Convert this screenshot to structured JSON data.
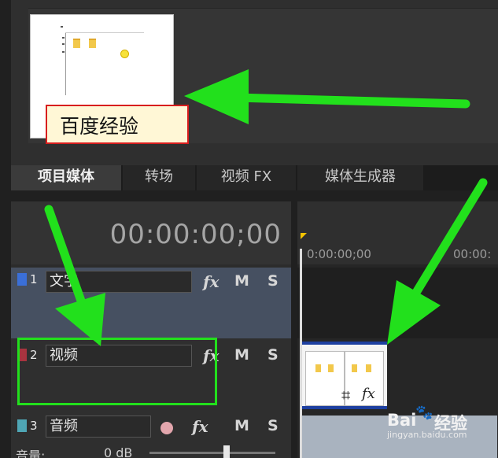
{
  "preview": {
    "label": "百度经验"
  },
  "tabs": [
    {
      "label": "项目媒体",
      "active": true
    },
    {
      "label": "转场",
      "active": false
    },
    {
      "label": "视频 FX",
      "active": false
    },
    {
      "label": "媒体生成器",
      "active": false
    }
  ],
  "timecode": "00:00:00;00",
  "ruler": {
    "ticks": [
      "0:00:00;00",
      "00:00:"
    ]
  },
  "tracks": [
    {
      "number": "1",
      "name": "文字",
      "fx": "fx",
      "mute": "M",
      "solo": "S",
      "swatch": "#3a6fd8"
    },
    {
      "number": "2",
      "name": "视频",
      "fx": "fx",
      "mute": "M",
      "solo": "S",
      "swatch": "#a8343f"
    },
    {
      "number": "3",
      "name": "音频",
      "fx": "fx",
      "mute": "M",
      "solo": "S",
      "swatch": "#4fa6b5"
    }
  ],
  "audio": {
    "volume_label": "音量:",
    "volume_value": "0 dB"
  },
  "clip": {
    "fx": "fx"
  },
  "watermark": {
    "brand": "Bai",
    "brand_suffix": "经验",
    "url": "jingyan.baidu.com"
  },
  "colors": {
    "highlight": "#22e01c",
    "label_border": "#d81e1e"
  }
}
